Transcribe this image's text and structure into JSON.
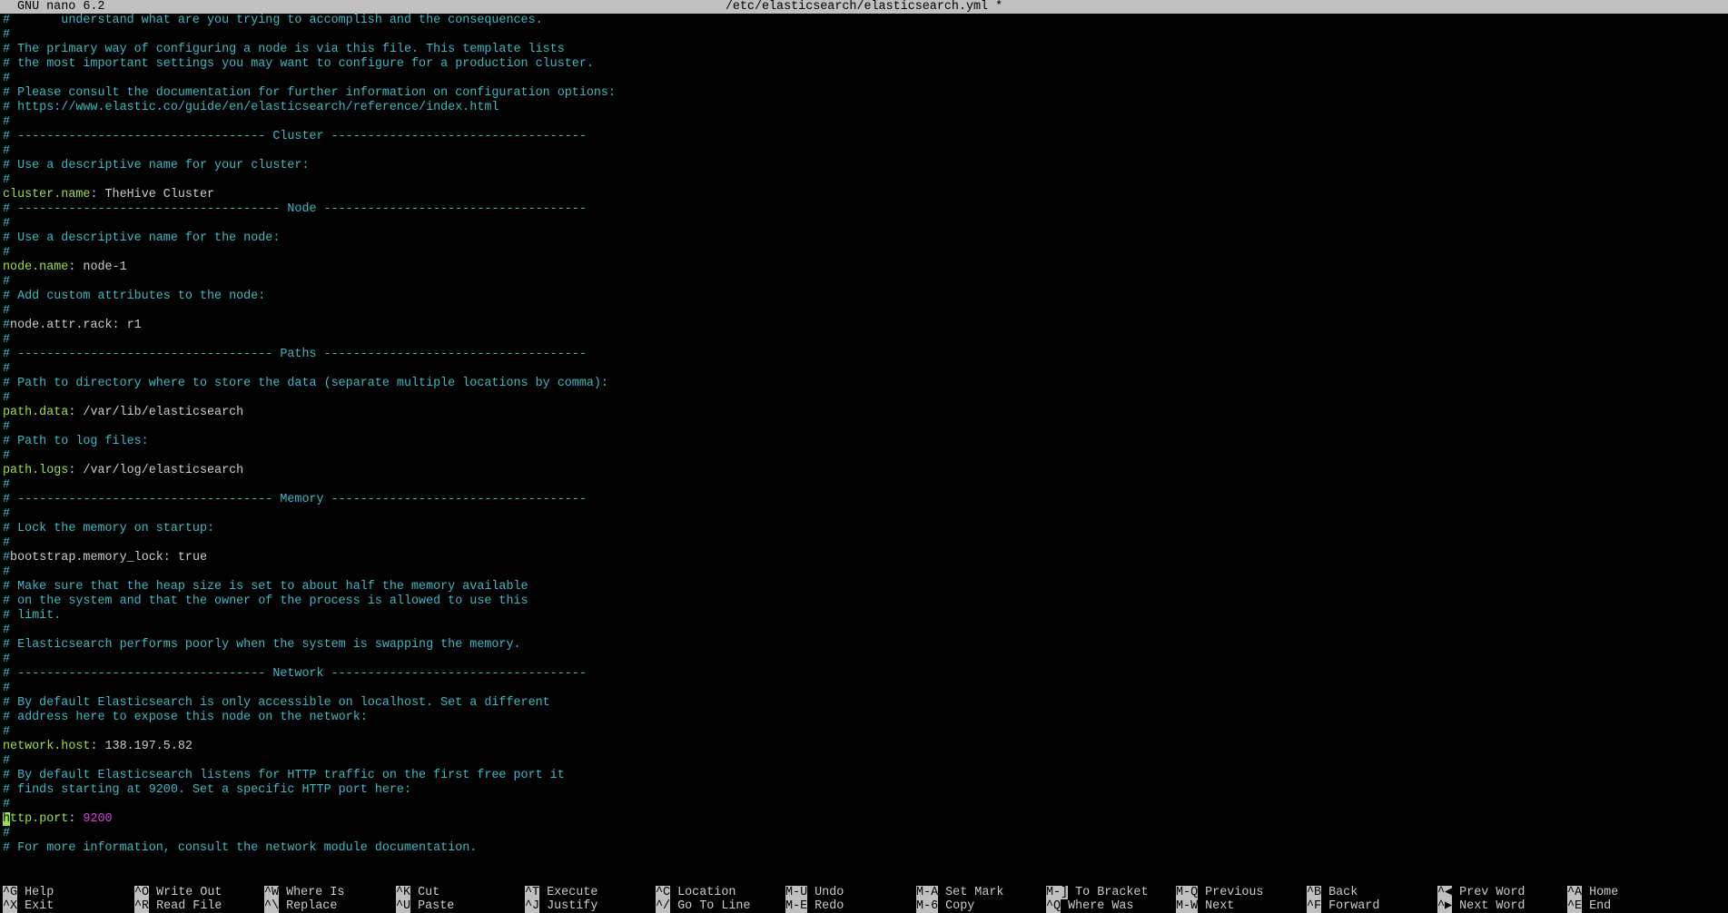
{
  "titlebar": {
    "app": "GNU nano 6.2",
    "file": "/etc/elasticsearch/elasticsearch.yml *"
  },
  "lines": [
    {
      "t": "comment",
      "text": "#       understand what are you trying to accomplish and the consequences."
    },
    {
      "t": "comment",
      "text": "#"
    },
    {
      "t": "comment",
      "text": "# The primary way of configuring a node is via this file. This template lists"
    },
    {
      "t": "comment",
      "text": "# the most important settings you may want to configure for a production cluster."
    },
    {
      "t": "comment",
      "text": "#"
    },
    {
      "t": "comment",
      "text": "# Please consult the documentation for further information on configuration options:"
    },
    {
      "t": "comment",
      "text": "# https://www.elastic.co/guide/en/elasticsearch/reference/index.html"
    },
    {
      "t": "comment",
      "text": "#"
    },
    {
      "t": "comment",
      "text": "# ---------------------------------- Cluster -----------------------------------"
    },
    {
      "t": "comment",
      "text": "#"
    },
    {
      "t": "comment",
      "text": "# Use a descriptive name for your cluster:"
    },
    {
      "t": "comment",
      "text": "#"
    },
    {
      "t": "setting",
      "key": "cluster.name",
      "value": "TheHive Cluster"
    },
    {
      "t": "comment",
      "text": "# ------------------------------------ Node ------------------------------------"
    },
    {
      "t": "comment",
      "text": "#"
    },
    {
      "t": "comment",
      "text": "# Use a descriptive name for the node:"
    },
    {
      "t": "comment",
      "text": "#"
    },
    {
      "t": "setting",
      "key": "node.name",
      "value": "node-1"
    },
    {
      "t": "comment",
      "text": "#"
    },
    {
      "t": "comment",
      "text": "# Add custom attributes to the node:"
    },
    {
      "t": "comment",
      "text": "#"
    },
    {
      "t": "disabled",
      "text": "#node.attr.rack: r1"
    },
    {
      "t": "comment",
      "text": "#"
    },
    {
      "t": "comment",
      "text": "# ----------------------------------- Paths ------------------------------------"
    },
    {
      "t": "comment",
      "text": "#"
    },
    {
      "t": "comment",
      "text": "# Path to directory where to store the data (separate multiple locations by comma):"
    },
    {
      "t": "comment",
      "text": "#"
    },
    {
      "t": "setting",
      "key": "path.data",
      "value": "/var/lib/elasticsearch"
    },
    {
      "t": "comment",
      "text": "#"
    },
    {
      "t": "comment",
      "text": "# Path to log files:"
    },
    {
      "t": "comment",
      "text": "#"
    },
    {
      "t": "setting",
      "key": "path.logs",
      "value": "/var/log/elasticsearch"
    },
    {
      "t": "comment",
      "text": "#"
    },
    {
      "t": "comment",
      "text": "# ----------------------------------- Memory -----------------------------------"
    },
    {
      "t": "comment",
      "text": "#"
    },
    {
      "t": "comment",
      "text": "# Lock the memory on startup:"
    },
    {
      "t": "comment",
      "text": "#"
    },
    {
      "t": "disabled",
      "text": "#bootstrap.memory_lock: true"
    },
    {
      "t": "comment",
      "text": "#"
    },
    {
      "t": "comment",
      "text": "# Make sure that the heap size is set to about half the memory available"
    },
    {
      "t": "comment",
      "text": "# on the system and that the owner of the process is allowed to use this"
    },
    {
      "t": "comment",
      "text": "# limit."
    },
    {
      "t": "comment",
      "text": "#"
    },
    {
      "t": "comment",
      "text": "# Elasticsearch performs poorly when the system is swapping the memory."
    },
    {
      "t": "comment",
      "text": "#"
    },
    {
      "t": "comment",
      "text": "# ---------------------------------- Network -----------------------------------"
    },
    {
      "t": "comment",
      "text": "#"
    },
    {
      "t": "comment",
      "text": "# By default Elasticsearch is only accessible on localhost. Set a different"
    },
    {
      "t": "comment",
      "text": "# address here to expose this node on the network:"
    },
    {
      "t": "comment",
      "text": "#"
    },
    {
      "t": "setting",
      "key": "network.host",
      "value": "138.197.5.82"
    },
    {
      "t": "comment",
      "text": "#"
    },
    {
      "t": "comment",
      "text": "# By default Elasticsearch listens for HTTP traffic on the first free port it"
    },
    {
      "t": "comment",
      "text": "# finds starting at 9200. Set a specific HTTP port here:"
    },
    {
      "t": "comment",
      "text": "#"
    },
    {
      "t": "setting_num",
      "key": "http.port",
      "value": "9200",
      "cursor": true
    },
    {
      "t": "comment",
      "text": "#"
    },
    {
      "t": "comment",
      "text": "# For more information, consult the network module documentation."
    }
  ],
  "shortcuts": [
    [
      {
        "key": "^G",
        "label": "Help"
      },
      {
        "key": "^X",
        "label": "Exit"
      }
    ],
    [
      {
        "key": "^O",
        "label": "Write Out"
      },
      {
        "key": "^R",
        "label": "Read File"
      }
    ],
    [
      {
        "key": "^W",
        "label": "Where Is"
      },
      {
        "key": "^\\",
        "label": "Replace"
      }
    ],
    [
      {
        "key": "^K",
        "label": "Cut"
      },
      {
        "key": "^U",
        "label": "Paste"
      }
    ],
    [
      {
        "key": "^T",
        "label": "Execute"
      },
      {
        "key": "^J",
        "label": "Justify"
      }
    ],
    [
      {
        "key": "^C",
        "label": "Location"
      },
      {
        "key": "^/",
        "label": "Go To Line"
      }
    ],
    [
      {
        "key": "M-U",
        "label": "Undo"
      },
      {
        "key": "M-E",
        "label": "Redo"
      }
    ],
    [
      {
        "key": "M-A",
        "label": "Set Mark"
      },
      {
        "key": "M-6",
        "label": "Copy"
      }
    ],
    [
      {
        "key": "M-]",
        "label": "To Bracket"
      },
      {
        "key": "^Q",
        "label": "Where Was"
      }
    ],
    [
      {
        "key": "M-Q",
        "label": "Previous"
      },
      {
        "key": "M-W",
        "label": "Next"
      }
    ],
    [
      {
        "key": "^B",
        "label": "Back"
      },
      {
        "key": "^F",
        "label": "Forward"
      }
    ],
    [
      {
        "key": "^◀",
        "label": "Prev Word"
      },
      {
        "key": "^▶",
        "label": "Next Word"
      }
    ],
    [
      {
        "key": "^A",
        "label": "Home"
      },
      {
        "key": "^E",
        "label": "End"
      }
    ]
  ],
  "colors": {
    "comment": "#3bb9c6",
    "key": "#9be14c",
    "number": "#d146d6",
    "text": "#cccccc",
    "background": "#000000",
    "bar": "#c0c0c0"
  }
}
